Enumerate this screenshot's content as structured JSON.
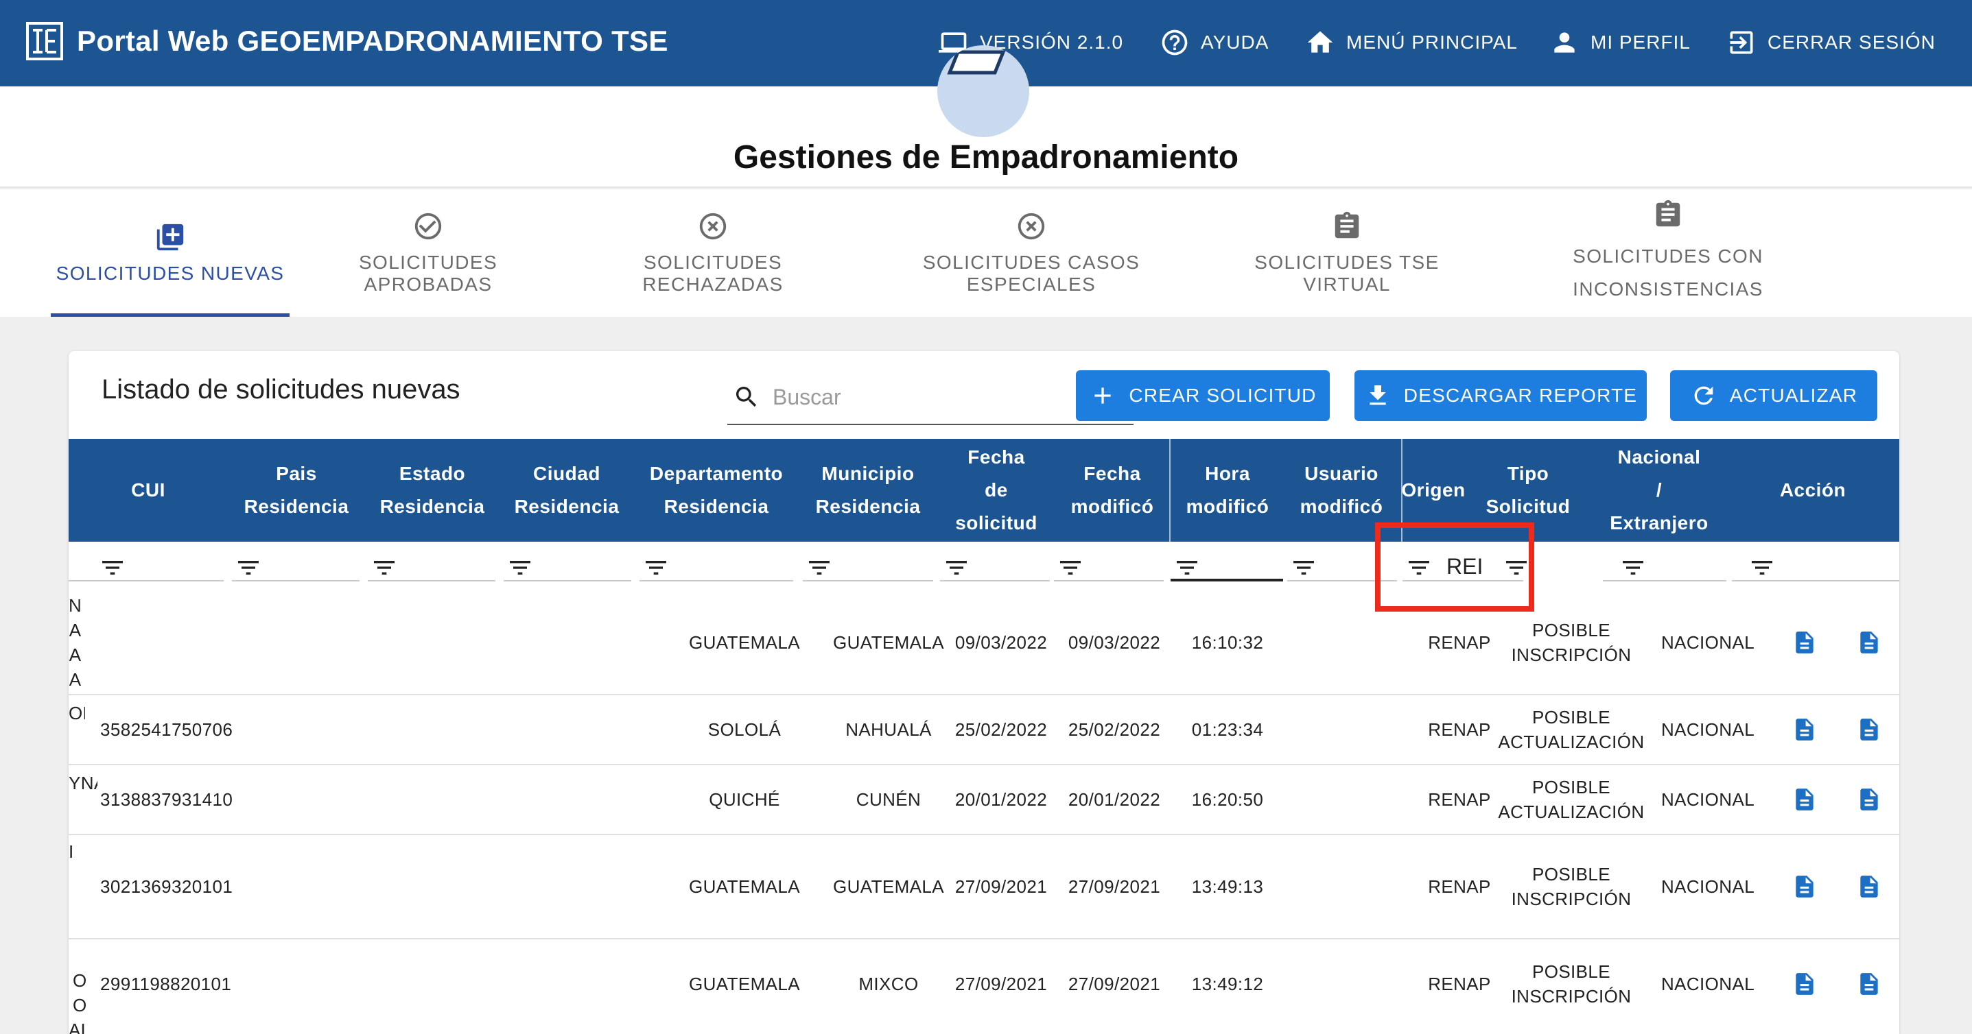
{
  "app": {
    "title": "Portal Web GEOEMPADRONAMIENTO TSE"
  },
  "nav": {
    "version": "VERSIÓN 2.1.0",
    "help": "AYUDA",
    "main_menu": "MENÚ PRINCIPAL",
    "profile": "MI PERFIL",
    "logout": "CERRAR SESIÓN"
  },
  "page": {
    "title": "Gestiones de Empadronamiento"
  },
  "tabs": [
    {
      "label": "SOLICITUDES NUEVAS",
      "icon": "add-box-icon",
      "active": true
    },
    {
      "label": "SOLICITUDES APROBADAS",
      "icon": "check-circle-icon"
    },
    {
      "label": "SOLICITUDES RECHAZADAS",
      "icon": "cancel-circle-icon"
    },
    {
      "label": "SOLICITUDES CASOS ESPECIALES",
      "icon": "cancel-circle-icon"
    },
    {
      "label": "SOLICITUDES TSE VIRTUAL",
      "icon": "clipboard-icon"
    },
    {
      "label_line1": "SOLICITUDES CON",
      "label_line2": "INCONSISTENCIAS",
      "icon": "clipboard-icon"
    }
  ],
  "card": {
    "title": "Listado de solicitudes nuevas",
    "search_placeholder": "Buscar",
    "create_button": "CREAR SOLICITUD",
    "download_button": "DESCARGAR REPORTE",
    "refresh_button": "ACTUALIZAR"
  },
  "table": {
    "headers": {
      "cui": "CUI",
      "pais": [
        "Pais",
        "Residencia"
      ],
      "estado": [
        "Estado",
        "Residencia"
      ],
      "ciudad": [
        "Ciudad",
        "Residencia"
      ],
      "departamento": [
        "Departamento",
        "Residencia"
      ],
      "municipio": [
        "Municipio",
        "Residencia"
      ],
      "fecha_solicitud": [
        "Fecha",
        "de",
        "solicitud"
      ],
      "fecha_modifico": [
        "Fecha",
        "modificó"
      ],
      "hora_modifico": [
        "Hora",
        "modificó"
      ],
      "usuario_modifico": [
        "Usuario",
        "modificó"
      ],
      "origen": "Origen",
      "tipo_solicitud": [
        "Tipo",
        "Solicitud"
      ],
      "nacional": [
        "Nacional",
        "/",
        "Extranjero"
      ],
      "accion": "Acción"
    },
    "origen_filter_value": "REI",
    "rows": [
      {
        "trunc": "N\nA\nA\nA",
        "cui": "",
        "departamento": "GUATEMALA",
        "municipio": "GUATEMALA",
        "fecha_solicitud": "09/03/2022",
        "fecha_modifico": "09/03/2022",
        "hora": "16:10:32",
        "origen": "RENAP",
        "tipo": [
          "POSIBLE",
          "INSCRIPCIÓN"
        ],
        "nacional": "NACIONAL"
      },
      {
        "trunc": "ON",
        "cui": "3582541750706",
        "departamento": "SOLOLÁ",
        "municipio": "NAHUALÁ",
        "fecha_solicitud": "25/02/2022",
        "fecha_modifico": "25/02/2022",
        "hora": "01:23:34",
        "origen": "RENAP",
        "tipo": [
          "POSIBLE",
          "ACTUALIZACIÓN"
        ],
        "nacional": "NACIONAL"
      },
      {
        "trunc": "YNA",
        "cui": "3138837931410",
        "departamento": "QUICHÉ",
        "municipio": "CUNÉN",
        "fecha_solicitud": "20/01/2022",
        "fecha_modifico": "20/01/2022",
        "hora": "16:20:50",
        "origen": "RENAP",
        "tipo": [
          "POSIBLE",
          "ACTUALIZACIÓN"
        ],
        "nacional": "NACIONAL"
      },
      {
        "trunc": "I",
        "cui": "3021369320101",
        "departamento": "GUATEMALA",
        "municipio": "GUATEMALA",
        "fecha_solicitud": "27/09/2021",
        "fecha_modifico": "27/09/2021",
        "hora": "13:49:13",
        "origen": "RENAP",
        "tipo": [
          "POSIBLE",
          "INSCRIPCIÓN"
        ],
        "nacional": "NACIONAL"
      },
      {
        "trunc": "O\nO\nAL",
        "cui": "2991198820101",
        "departamento": "GUATEMALA",
        "municipio": "MIXCO",
        "fecha_solicitud": "27/09/2021",
        "fecha_modifico": "27/09/2021",
        "hora": "13:49:12",
        "origen": "RENAP",
        "tipo": [
          "POSIBLE",
          "INSCRIPCIÓN"
        ],
        "nacional": "NACIONAL"
      }
    ]
  },
  "colors": {
    "header_blue": "#1d5592",
    "button_blue": "#1d7ee0",
    "active_tab": "#2c4fa6",
    "highlight_red": "#ee2a1c"
  }
}
